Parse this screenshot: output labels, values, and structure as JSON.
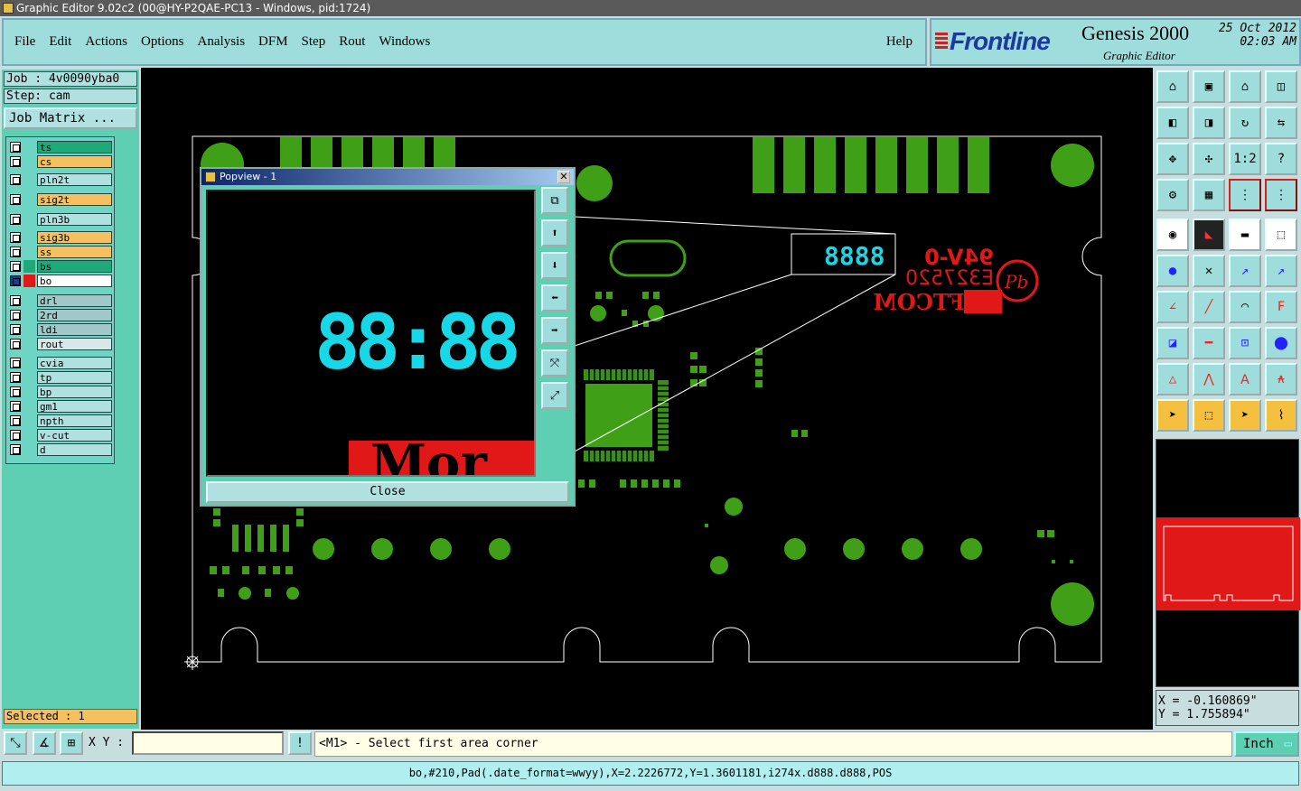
{
  "window": {
    "title": "Graphic Editor 9.02c2 (00@HY-P2QAE-PC13 - Windows, pid:1724)"
  },
  "menu": {
    "items": [
      "File",
      "Edit",
      "Actions",
      "Options",
      "Analysis",
      "DFM",
      "Step",
      "Rout",
      "Windows"
    ],
    "help": "Help"
  },
  "logo": {
    "brand": "Frontline",
    "product": "Genesis 2000",
    "subtitle": "Graphic Editor",
    "date": "25 Oct 2012",
    "time": "02:03 AM"
  },
  "job": {
    "label": "Job : 4v0090yba0",
    "step": "Step: cam",
    "matrix_button": "Job Matrix ..."
  },
  "layers": [
    {
      "name": "ts",
      "color": "#1fa878"
    },
    {
      "name": "cs",
      "color": "#f5c060"
    },
    {
      "name": "pln2t",
      "color": "#b0e0e0"
    },
    {
      "name": "sig2t",
      "color": "#f5c060"
    },
    {
      "name": "pln3b",
      "color": "#b0e0e0"
    },
    {
      "name": "sig3b",
      "color": "#f5c060"
    },
    {
      "name": "ss",
      "color": "#f5c060"
    },
    {
      "name": "bs",
      "color": "#1fa878"
    },
    {
      "name": "bo",
      "color": "#ffffff"
    },
    {
      "name": "drl",
      "color": "#a0c8c8"
    },
    {
      "name": "2rd",
      "color": "#a0c8c8"
    },
    {
      "name": "ldi",
      "color": "#a0c8c8"
    },
    {
      "name": "rout",
      "color": "#d8e8e8"
    },
    {
      "name": "cvia",
      "color": "#b0e0e0"
    },
    {
      "name": "tp",
      "color": "#b0e0e0"
    },
    {
      "name": "bp",
      "color": "#b0e0e0"
    },
    {
      "name": "gm1",
      "color": "#b0e0e0"
    },
    {
      "name": "npth",
      "color": "#b0e0e0"
    },
    {
      "name": "v-cut",
      "color": "#b0e0e0"
    },
    {
      "name": "d",
      "color": "#b0e0e0"
    }
  ],
  "selected": "Selected : 1",
  "popup": {
    "title": "Popview - 1",
    "close_label": "Close",
    "close_x": "✕"
  },
  "canvas": {
    "marking1": "94V-0",
    "marking2": "E327520",
    "marking3": "SOFTCOM",
    "digits": "8888",
    "popup_digits": "88:88",
    "popup_text": "Mor",
    "pb": "Pb"
  },
  "coords": {
    "x": "X = -0.160869\"",
    "y": "Y = 1.755894\""
  },
  "status": {
    "xy_label": "X Y :",
    "xy_value": "",
    "message": "<M1> - Select first area corner",
    "unit": "Inch",
    "info": "bo,#210,Pad(.date_format=wwyy),X=2.2226772,Y=1.3601181,i274x.d888.d888,POS"
  },
  "colors": {
    "copper": "#3fa018",
    "silk": "#e01818",
    "panel": "#5fcfb3",
    "cyan": "#18d8e8"
  }
}
